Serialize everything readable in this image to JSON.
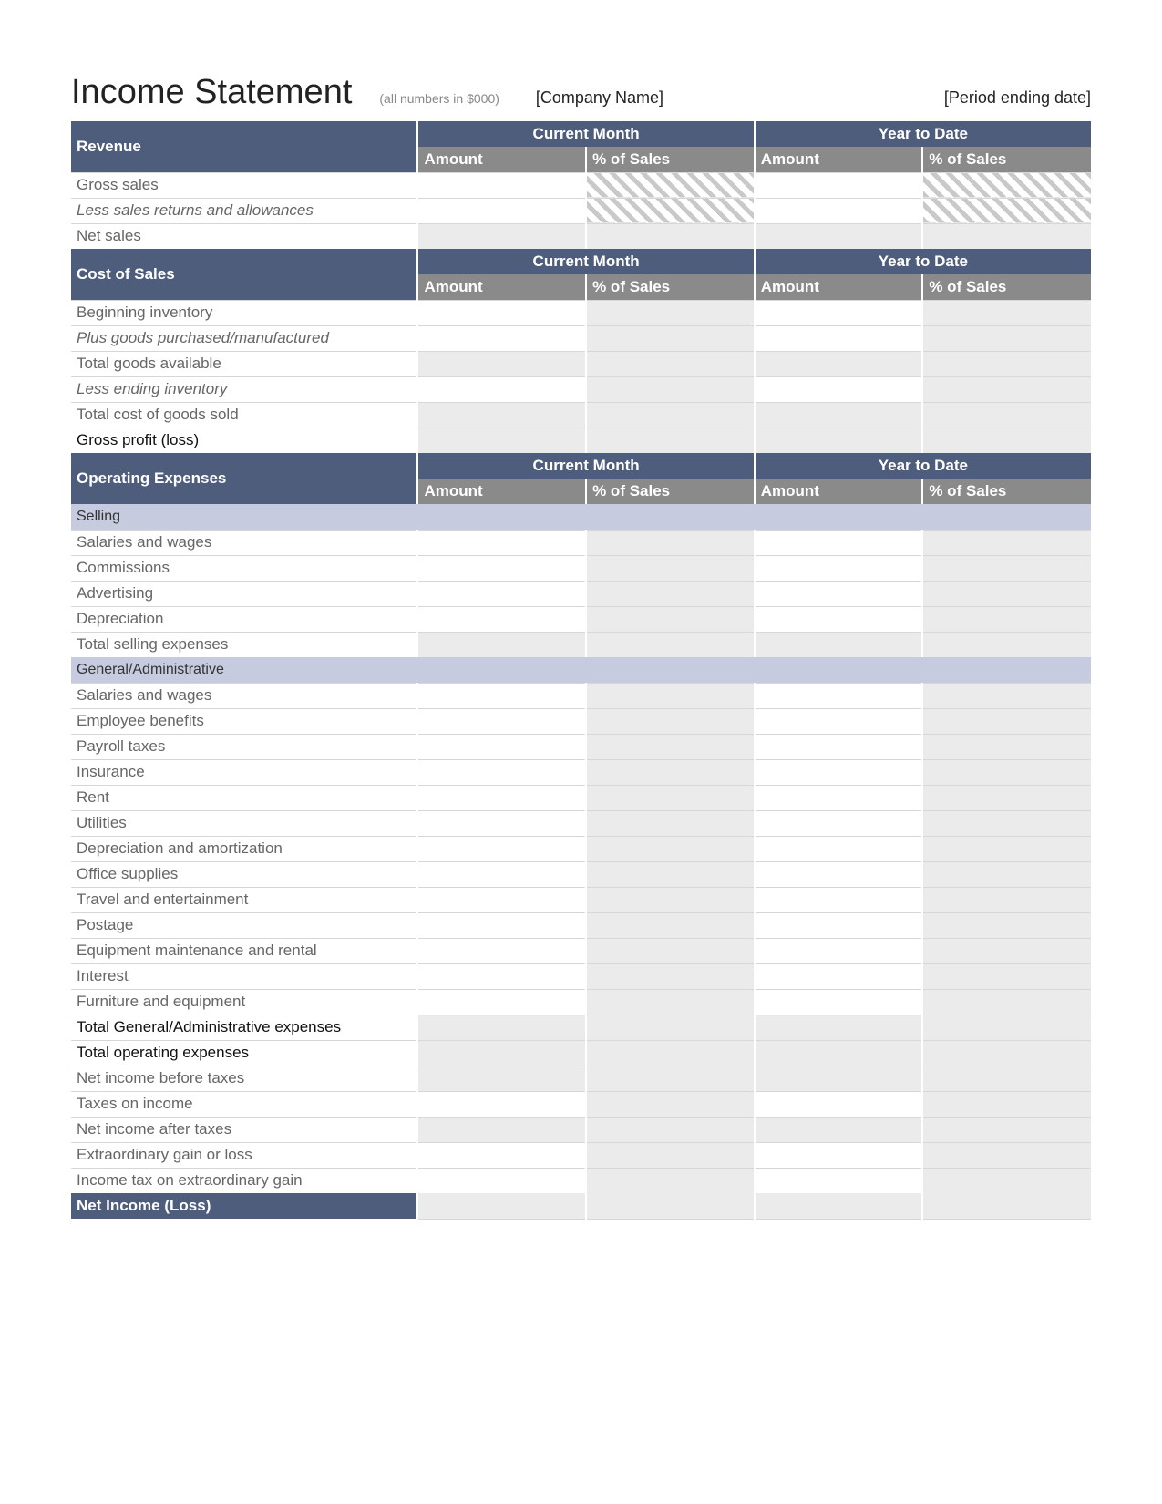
{
  "header": {
    "title": "Income Statement",
    "note": "(all numbers in $000)",
    "company": "[Company Name]",
    "period": "[Period ending date]"
  },
  "periods": {
    "current": "Current Month",
    "ytd": "Year to Date"
  },
  "cols": {
    "amount": "Amount",
    "pct": "% of Sales"
  },
  "sections": {
    "revenue": "Revenue",
    "cos": "Cost of Sales",
    "opex": "Operating Expenses"
  },
  "subsections": {
    "selling": "Selling",
    "ga": "General/Administrative"
  },
  "rows": {
    "gross_sales": "Gross sales",
    "less_returns": "Less sales returns and allowances",
    "net_sales": "Net sales",
    "beg_inv": "Beginning inventory",
    "plus_goods": "Plus goods purchased/manufactured",
    "total_goods": "Total goods available",
    "less_end_inv": "Less ending inventory",
    "total_cogs": "Total cost of goods sold",
    "gross_profit": "Gross profit (loss)",
    "sell_salaries": "Salaries and wages",
    "sell_commissions": "Commissions",
    "sell_advertising": "Advertising",
    "sell_depreciation": "Depreciation",
    "sell_total": "Total selling expenses",
    "ga_salaries": "Salaries and wages",
    "ga_benefits": "Employee benefits",
    "ga_payroll_tax": "Payroll taxes",
    "ga_insurance": "Insurance",
    "ga_rent": "Rent",
    "ga_utilities": "Utilities",
    "ga_dep_amort": "Depreciation and amortization",
    "ga_office": "Office supplies",
    "ga_travel": "Travel and entertainment",
    "ga_postage": "Postage",
    "ga_equip": "Equipment maintenance and rental",
    "ga_interest": "Interest",
    "ga_furniture": "Furniture and equipment",
    "ga_total": "Total General/Administrative expenses",
    "opex_total": "Total operating expenses",
    "net_before_tax": "Net income before taxes",
    "taxes": "Taxes on income",
    "net_after_tax": "Net income after taxes",
    "extra_gain": "Extraordinary gain or loss",
    "extra_tax": "Income tax on extraordinary gain",
    "net_income": "Net Income (Loss)"
  }
}
